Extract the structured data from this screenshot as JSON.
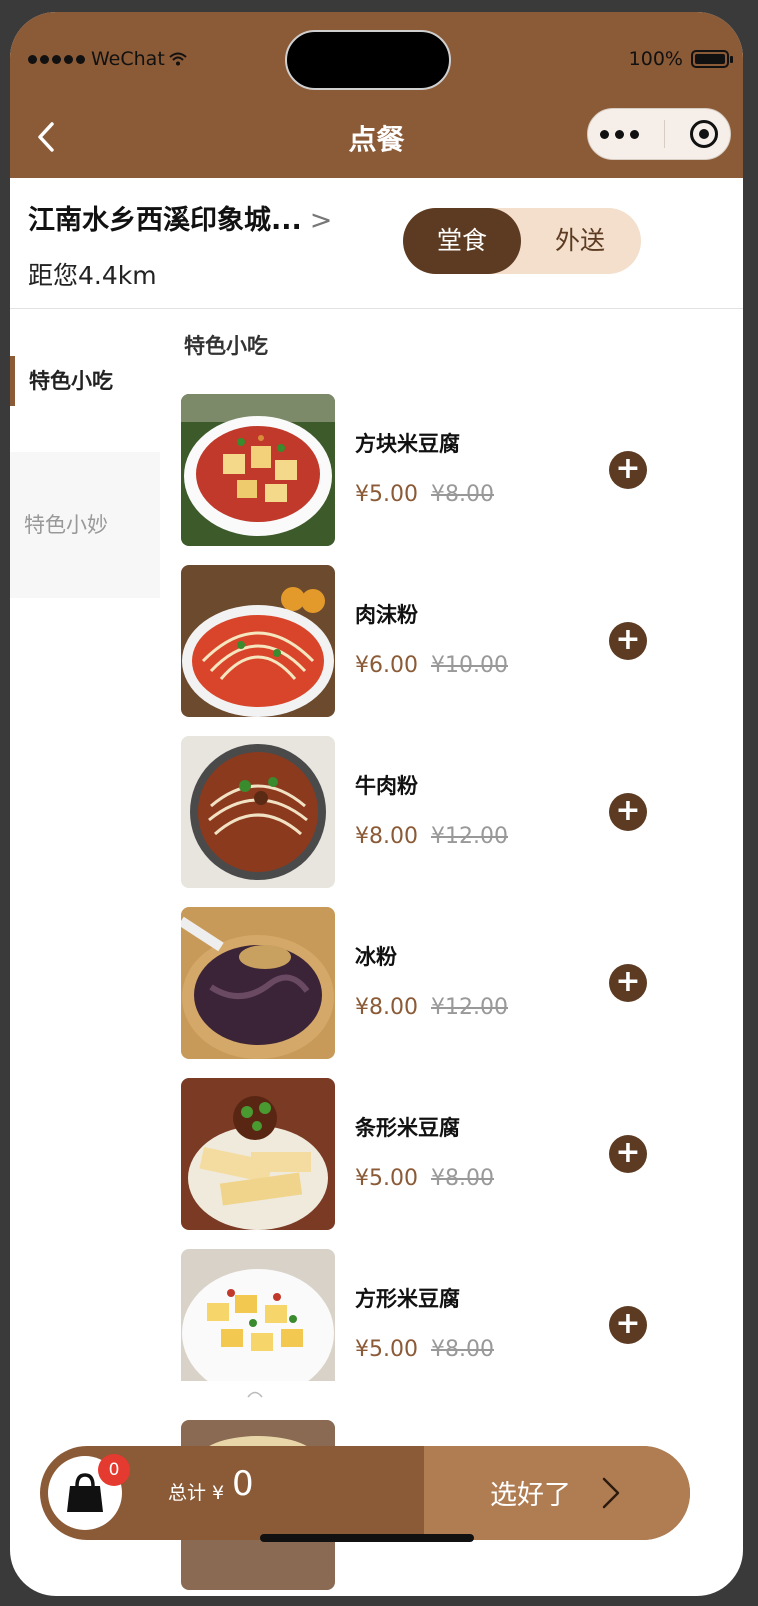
{
  "status_bar": {
    "carrier": "WeChat",
    "battery": "100%"
  },
  "nav": {
    "title": "点餐"
  },
  "store": {
    "name": "江南水乡西溪印象城...",
    "arrow": ">",
    "distance": "距您4.4km"
  },
  "order_mode": {
    "options": [
      "堂食",
      "外送"
    ],
    "selected": "堂食"
  },
  "sidebar": {
    "items": [
      {
        "label": "特色小吃",
        "active": true
      },
      {
        "label": "特色小妙",
        "active": false
      }
    ]
  },
  "section": {
    "title": "特色小吃"
  },
  "menu": [
    {
      "name": "方块米豆腐",
      "price": "¥5.00",
      "original_price": "¥8.00"
    },
    {
      "name": "肉沫粉",
      "price": "¥6.00",
      "original_price": "¥10.00"
    },
    {
      "name": "牛肉粉",
      "price": "¥8.00",
      "original_price": "¥12.00"
    },
    {
      "name": "冰粉",
      "price": "¥8.00",
      "original_price": "¥12.00"
    },
    {
      "name": "条形米豆腐",
      "price": "¥5.00",
      "original_price": "¥8.00"
    },
    {
      "name": "方形米豆腐",
      "price": "¥5.00",
      "original_price": "¥8.00"
    }
  ],
  "cart": {
    "count": "0",
    "total_label": "总计 ¥",
    "total": "0",
    "checkout_label": "选好了"
  },
  "colors": {
    "brand": "#8b5a36",
    "dark": "#5c3b22",
    "light": "#f3dfcc",
    "badge": "#e53a2f"
  }
}
